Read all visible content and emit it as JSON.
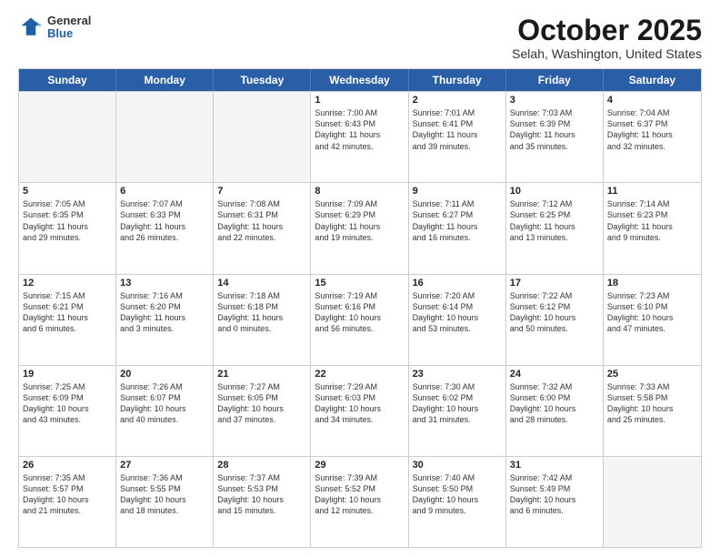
{
  "header": {
    "logo": {
      "general": "General",
      "blue": "Blue"
    },
    "title": "October 2025",
    "location": "Selah, Washington, United States"
  },
  "days_of_week": [
    "Sunday",
    "Monday",
    "Tuesday",
    "Wednesday",
    "Thursday",
    "Friday",
    "Saturday"
  ],
  "weeks": [
    [
      {
        "day": "",
        "empty": true,
        "lines": []
      },
      {
        "day": "",
        "empty": true,
        "lines": []
      },
      {
        "day": "",
        "empty": true,
        "lines": []
      },
      {
        "day": "1",
        "empty": false,
        "lines": [
          "Sunrise: 7:00 AM",
          "Sunset: 6:43 PM",
          "Daylight: 11 hours",
          "and 42 minutes."
        ]
      },
      {
        "day": "2",
        "empty": false,
        "lines": [
          "Sunrise: 7:01 AM",
          "Sunset: 6:41 PM",
          "Daylight: 11 hours",
          "and 39 minutes."
        ]
      },
      {
        "day": "3",
        "empty": false,
        "lines": [
          "Sunrise: 7:03 AM",
          "Sunset: 6:39 PM",
          "Daylight: 11 hours",
          "and 35 minutes."
        ]
      },
      {
        "day": "4",
        "empty": false,
        "lines": [
          "Sunrise: 7:04 AM",
          "Sunset: 6:37 PM",
          "Daylight: 11 hours",
          "and 32 minutes."
        ]
      }
    ],
    [
      {
        "day": "5",
        "empty": false,
        "lines": [
          "Sunrise: 7:05 AM",
          "Sunset: 6:35 PM",
          "Daylight: 11 hours",
          "and 29 minutes."
        ]
      },
      {
        "day": "6",
        "empty": false,
        "lines": [
          "Sunrise: 7:07 AM",
          "Sunset: 6:33 PM",
          "Daylight: 11 hours",
          "and 26 minutes."
        ]
      },
      {
        "day": "7",
        "empty": false,
        "lines": [
          "Sunrise: 7:08 AM",
          "Sunset: 6:31 PM",
          "Daylight: 11 hours",
          "and 22 minutes."
        ]
      },
      {
        "day": "8",
        "empty": false,
        "lines": [
          "Sunrise: 7:09 AM",
          "Sunset: 6:29 PM",
          "Daylight: 11 hours",
          "and 19 minutes."
        ]
      },
      {
        "day": "9",
        "empty": false,
        "lines": [
          "Sunrise: 7:11 AM",
          "Sunset: 6:27 PM",
          "Daylight: 11 hours",
          "and 16 minutes."
        ]
      },
      {
        "day": "10",
        "empty": false,
        "lines": [
          "Sunrise: 7:12 AM",
          "Sunset: 6:25 PM",
          "Daylight: 11 hours",
          "and 13 minutes."
        ]
      },
      {
        "day": "11",
        "empty": false,
        "lines": [
          "Sunrise: 7:14 AM",
          "Sunset: 6:23 PM",
          "Daylight: 11 hours",
          "and 9 minutes."
        ]
      }
    ],
    [
      {
        "day": "12",
        "empty": false,
        "lines": [
          "Sunrise: 7:15 AM",
          "Sunset: 6:21 PM",
          "Daylight: 11 hours",
          "and 6 minutes."
        ]
      },
      {
        "day": "13",
        "empty": false,
        "lines": [
          "Sunrise: 7:16 AM",
          "Sunset: 6:20 PM",
          "Daylight: 11 hours",
          "and 3 minutes."
        ]
      },
      {
        "day": "14",
        "empty": false,
        "lines": [
          "Sunrise: 7:18 AM",
          "Sunset: 6:18 PM",
          "Daylight: 11 hours",
          "and 0 minutes."
        ]
      },
      {
        "day": "15",
        "empty": false,
        "lines": [
          "Sunrise: 7:19 AM",
          "Sunset: 6:16 PM",
          "Daylight: 10 hours",
          "and 56 minutes."
        ]
      },
      {
        "day": "16",
        "empty": false,
        "lines": [
          "Sunrise: 7:20 AM",
          "Sunset: 6:14 PM",
          "Daylight: 10 hours",
          "and 53 minutes."
        ]
      },
      {
        "day": "17",
        "empty": false,
        "lines": [
          "Sunrise: 7:22 AM",
          "Sunset: 6:12 PM",
          "Daylight: 10 hours",
          "and 50 minutes."
        ]
      },
      {
        "day": "18",
        "empty": false,
        "lines": [
          "Sunrise: 7:23 AM",
          "Sunset: 6:10 PM",
          "Daylight: 10 hours",
          "and 47 minutes."
        ]
      }
    ],
    [
      {
        "day": "19",
        "empty": false,
        "lines": [
          "Sunrise: 7:25 AM",
          "Sunset: 6:09 PM",
          "Daylight: 10 hours",
          "and 43 minutes."
        ]
      },
      {
        "day": "20",
        "empty": false,
        "lines": [
          "Sunrise: 7:26 AM",
          "Sunset: 6:07 PM",
          "Daylight: 10 hours",
          "and 40 minutes."
        ]
      },
      {
        "day": "21",
        "empty": false,
        "lines": [
          "Sunrise: 7:27 AM",
          "Sunset: 6:05 PM",
          "Daylight: 10 hours",
          "and 37 minutes."
        ]
      },
      {
        "day": "22",
        "empty": false,
        "lines": [
          "Sunrise: 7:29 AM",
          "Sunset: 6:03 PM",
          "Daylight: 10 hours",
          "and 34 minutes."
        ]
      },
      {
        "day": "23",
        "empty": false,
        "lines": [
          "Sunrise: 7:30 AM",
          "Sunset: 6:02 PM",
          "Daylight: 10 hours",
          "and 31 minutes."
        ]
      },
      {
        "day": "24",
        "empty": false,
        "lines": [
          "Sunrise: 7:32 AM",
          "Sunset: 6:00 PM",
          "Daylight: 10 hours",
          "and 28 minutes."
        ]
      },
      {
        "day": "25",
        "empty": false,
        "lines": [
          "Sunrise: 7:33 AM",
          "Sunset: 5:58 PM",
          "Daylight: 10 hours",
          "and 25 minutes."
        ]
      }
    ],
    [
      {
        "day": "26",
        "empty": false,
        "lines": [
          "Sunrise: 7:35 AM",
          "Sunset: 5:57 PM",
          "Daylight: 10 hours",
          "and 21 minutes."
        ]
      },
      {
        "day": "27",
        "empty": false,
        "lines": [
          "Sunrise: 7:36 AM",
          "Sunset: 5:55 PM",
          "Daylight: 10 hours",
          "and 18 minutes."
        ]
      },
      {
        "day": "28",
        "empty": false,
        "lines": [
          "Sunrise: 7:37 AM",
          "Sunset: 5:53 PM",
          "Daylight: 10 hours",
          "and 15 minutes."
        ]
      },
      {
        "day": "29",
        "empty": false,
        "lines": [
          "Sunrise: 7:39 AM",
          "Sunset: 5:52 PM",
          "Daylight: 10 hours",
          "and 12 minutes."
        ]
      },
      {
        "day": "30",
        "empty": false,
        "lines": [
          "Sunrise: 7:40 AM",
          "Sunset: 5:50 PM",
          "Daylight: 10 hours",
          "and 9 minutes."
        ]
      },
      {
        "day": "31",
        "empty": false,
        "lines": [
          "Sunrise: 7:42 AM",
          "Sunset: 5:49 PM",
          "Daylight: 10 hours",
          "and 6 minutes."
        ]
      },
      {
        "day": "",
        "empty": true,
        "lines": []
      }
    ]
  ]
}
